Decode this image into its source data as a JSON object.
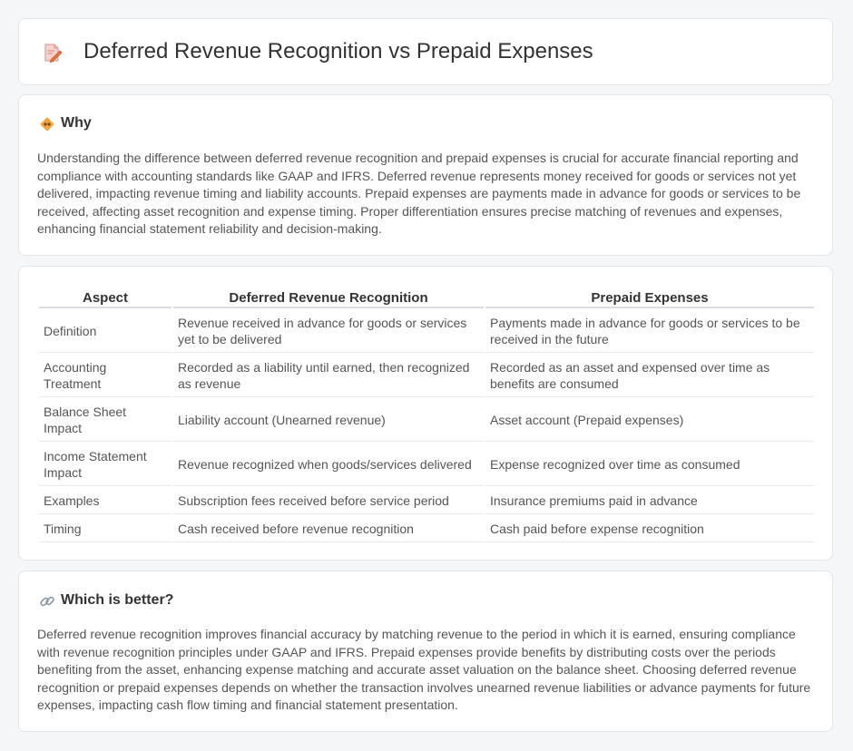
{
  "header": {
    "title": "Deferred Revenue Recognition vs Prepaid Expenses",
    "icon": "document-pen-icon"
  },
  "why": {
    "title": "Why",
    "icon": "diamond-hands-icon",
    "text": "Understanding the difference between deferred revenue recognition and prepaid expenses is crucial for accurate financial reporting and compliance with accounting standards like GAAP and IFRS. Deferred revenue represents money received for goods or services not yet delivered, impacting revenue timing and liability accounts. Prepaid expenses are payments made in advance for goods or services to be received, affecting asset recognition and expense timing. Proper differentiation ensures precise matching of revenues and expenses, enhancing financial statement reliability and decision-making."
  },
  "table": {
    "headers": [
      "Aspect",
      "Deferred Revenue Recognition",
      "Prepaid Expenses"
    ],
    "rows": [
      [
        "Definition",
        "Revenue received in advance for goods or services yet to be delivered",
        "Payments made in advance for goods or services to be received in the future"
      ],
      [
        "Accounting Treatment",
        "Recorded as a liability until earned, then recognized as revenue",
        "Recorded as an asset and expensed over time as benefits are consumed"
      ],
      [
        "Balance Sheet Impact",
        "Liability account (Unearned revenue)",
        "Asset account (Prepaid expenses)"
      ],
      [
        "Income Statement Impact",
        "Revenue recognized when goods/services delivered",
        "Expense recognized over time as consumed"
      ],
      [
        "Examples",
        "Subscription fees received before service period",
        "Insurance premiums paid in advance"
      ],
      [
        "Timing",
        "Cash received before revenue recognition",
        "Cash paid before expense recognition"
      ]
    ]
  },
  "better": {
    "title": "Which is better?",
    "icon": "link-icon",
    "text": "Deferred revenue recognition improves financial accuracy by matching revenue to the period in which it is earned, ensuring compliance with revenue recognition principles under GAAP and IFRS. Prepaid expenses provide benefits by distributing costs over the periods benefiting from the asset, enhancing expense matching and accurate asset valuation on the balance sheet. Choosing deferred revenue recognition or prepaid expenses depends on whether the transaction involves unearned revenue liabilities or advance payments for future expenses, impacting cash flow timing and financial statement presentation."
  }
}
